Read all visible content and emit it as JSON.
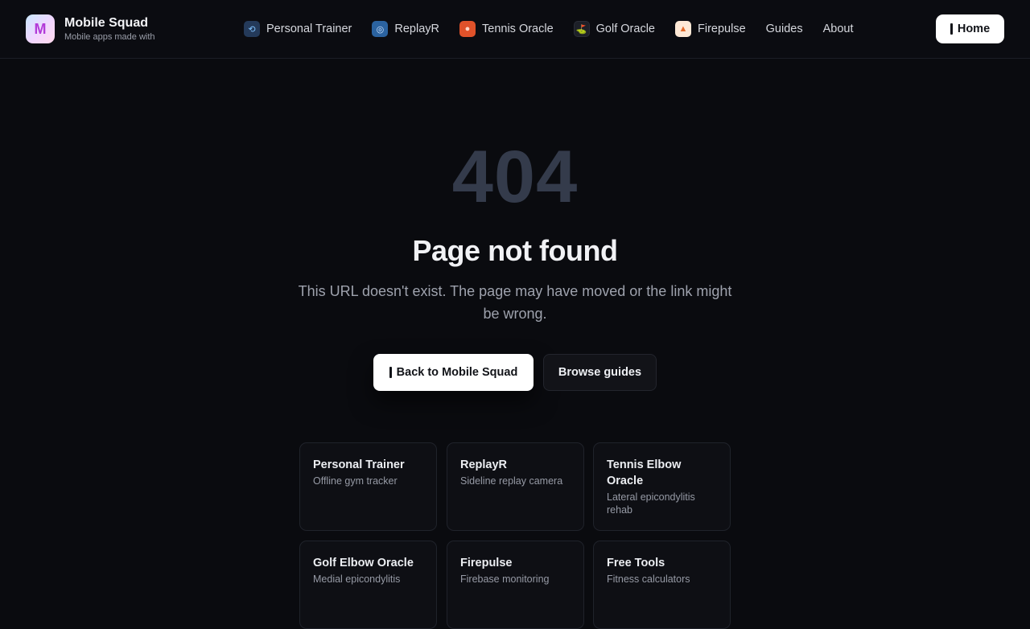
{
  "brand": {
    "name": "Mobile Squad",
    "tagline": "Mobile apps made with",
    "logo_letter": "M"
  },
  "nav": {
    "items": [
      {
        "label": "Personal Trainer",
        "icon": "dumbbell-app-icon"
      },
      {
        "label": "ReplayR",
        "icon": "camera-app-icon"
      },
      {
        "label": "Tennis Oracle",
        "icon": "tennis-app-icon"
      },
      {
        "label": "Golf Oracle",
        "icon": "golf-app-icon"
      },
      {
        "label": "Firepulse",
        "icon": "fire-app-icon"
      },
      {
        "label": "Guides"
      },
      {
        "label": "About"
      }
    ],
    "home_label": "Home"
  },
  "error": {
    "code": "404",
    "title": "Page not found",
    "description": "This URL doesn't exist. The page may have moved or the link might be wrong."
  },
  "actions": {
    "primary": "Back to Mobile Squad",
    "secondary": "Browse guides"
  },
  "apps": [
    {
      "title": "Personal Trainer",
      "subtitle": "Offline gym tracker"
    },
    {
      "title": "ReplayR",
      "subtitle": "Sideline replay camera"
    },
    {
      "title": "Tennis Elbow Oracle",
      "subtitle": "Lateral epicondylitis rehab"
    },
    {
      "title": "Golf Elbow Oracle",
      "subtitle": "Medial epicondylitis"
    },
    {
      "title": "Firepulse",
      "subtitle": "Firebase monitoring"
    },
    {
      "title": "Free Tools",
      "subtitle": "Fitness calculators"
    }
  ],
  "colors": {
    "background": "#0a0b0f",
    "primary_button": "#ffffff",
    "code_text": "#343b4b"
  }
}
